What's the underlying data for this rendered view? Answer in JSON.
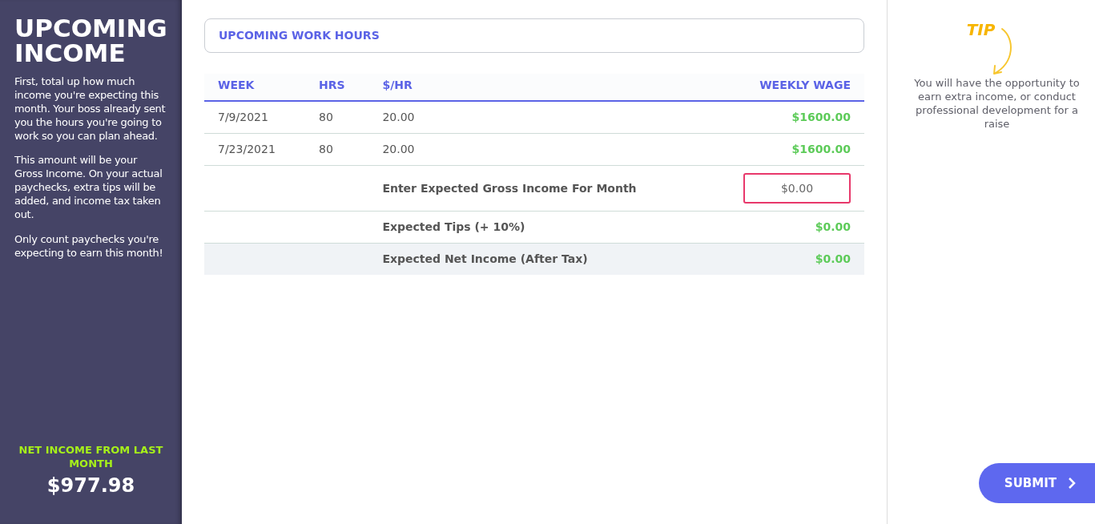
{
  "sidebar": {
    "title": "UPCOMING INCOME",
    "paragraphs": [
      "First, total up how much income you're expecting this month. Your boss already sent you the hours you're going to work so you can plan ahead.",
      "This amount will be your Gross Income. On your actual paychecks, extra tips will be added, and income tax taken out.",
      "Only count paychecks you're expecting to earn this month!"
    ],
    "net_income_label": "NET INCOME FROM LAST MONTH",
    "net_income_value": "$977.98"
  },
  "section_title": "UPCOMING WORK HOURS",
  "table": {
    "columns": [
      "WEEK",
      "HRS",
      "$/HR",
      "WEEKLY WAGE"
    ],
    "rows": [
      {
        "week": "7/9/2021",
        "hrs": "80",
        "rate": "20.00",
        "wage": "$1600.00"
      },
      {
        "week": "7/23/2021",
        "hrs": "80",
        "rate": "20.00",
        "wage": "$1600.00"
      }
    ],
    "summary": [
      {
        "kind": "input",
        "label": "Enter Expected Gross Income For Month",
        "placeholder": "$0.00"
      },
      {
        "kind": "value",
        "label": "Expected Tips (+ 10%)",
        "value": "$0.00"
      },
      {
        "kind": "total",
        "label": "Expected Net Income (After Tax)",
        "value": "$0.00"
      }
    ]
  },
  "tip": {
    "heading": "TIP",
    "text": "You will have the opportunity to earn extra income, or conduct professional development for a raise"
  },
  "submit": {
    "label": "SUBMIT"
  }
}
